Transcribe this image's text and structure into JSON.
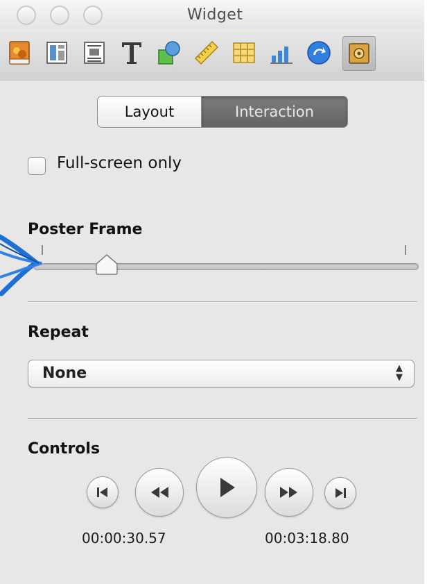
{
  "window": {
    "title": "Widget"
  },
  "toolbar": {
    "icons": [
      "document-icon",
      "layout-icon",
      "wrap-icon",
      "text-icon",
      "shapes-icon",
      "ruler-icon",
      "table-icon",
      "chart-icon",
      "link-icon",
      "quicktime-icon"
    ],
    "active_icon": "quicktime-icon"
  },
  "tabs": [
    {
      "label": "Layout",
      "selected": false
    },
    {
      "label": "Interaction",
      "selected": true
    }
  ],
  "fullscreen": {
    "label": "Full-screen only",
    "checked": false
  },
  "poster_frame": {
    "label": "Poster Frame",
    "value_fraction": 0.16
  },
  "repeat": {
    "label": "Repeat",
    "selected": "None"
  },
  "controls": {
    "label": "Controls",
    "current_time": "00:00:30.57",
    "duration": "00:03:18.80"
  },
  "colors": {
    "panel_background": "#e7e7e7",
    "annotation_arrow": "#1f6fd6",
    "active_segment": "#6f6f6f"
  }
}
